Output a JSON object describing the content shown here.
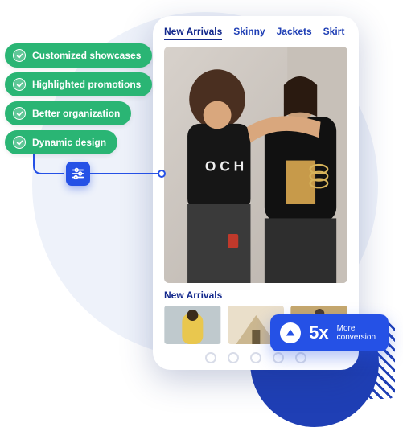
{
  "features": {
    "items": [
      "Customized showcases",
      "Highlighted promotions",
      "Better organization",
      "Dynamic design"
    ]
  },
  "app": {
    "tabs": [
      {
        "label": "New Arrivals",
        "active": true
      },
      {
        "label": "Skinny",
        "active": false
      },
      {
        "label": "Jackets",
        "active": false
      },
      {
        "label": "Skirt",
        "active": false
      }
    ],
    "section_title": "New Arrivals"
  },
  "conversion": {
    "value": "5x",
    "label_line1": "More",
    "label_line2": "conversion"
  },
  "colors": {
    "accent_blue": "#2551e6",
    "feature_green": "#2ab574",
    "deep_blue": "#12288c"
  }
}
